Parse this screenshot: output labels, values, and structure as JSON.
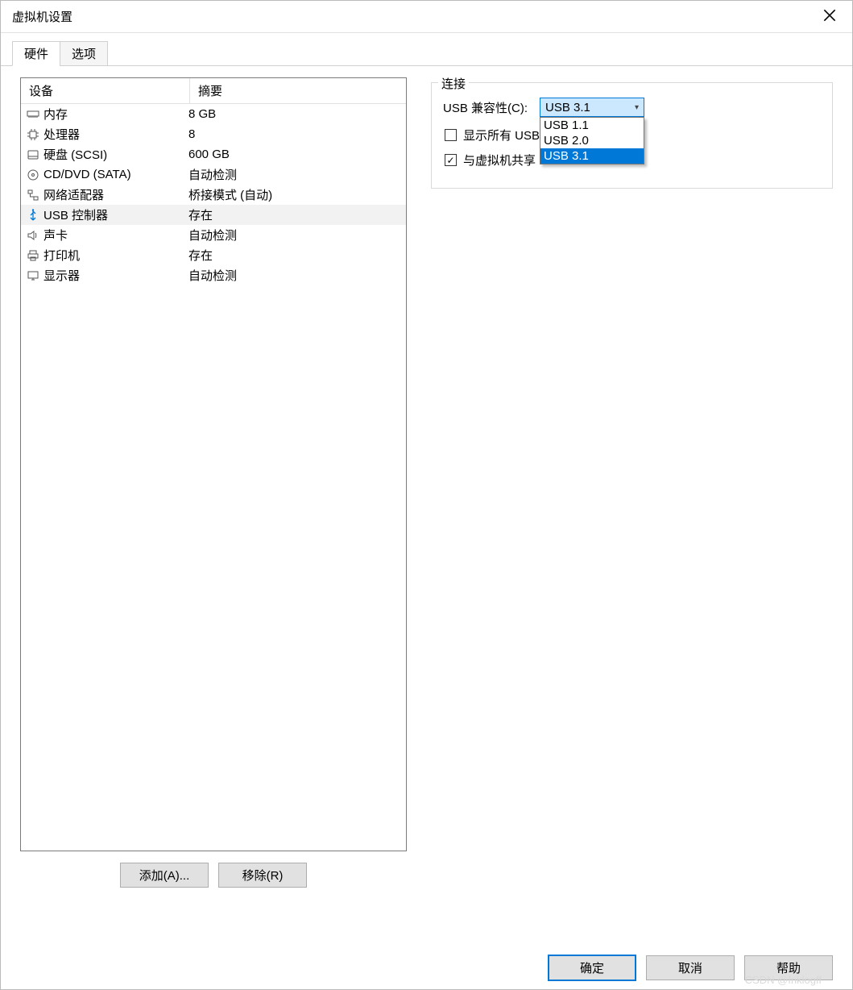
{
  "window": {
    "title": "虚拟机设置"
  },
  "tabs": {
    "hardware": "硬件",
    "options": "选项"
  },
  "list": {
    "header_device": "设备",
    "header_summary": "摘要",
    "items": [
      {
        "icon": "memory-icon",
        "label": "内存",
        "summary": "8 GB"
      },
      {
        "icon": "cpu-icon",
        "label": "处理器",
        "summary": "8"
      },
      {
        "icon": "disk-icon",
        "label": "硬盘 (SCSI)",
        "summary": "600 GB"
      },
      {
        "icon": "cd-icon",
        "label": "CD/DVD (SATA)",
        "summary": "自动检测"
      },
      {
        "icon": "network-icon",
        "label": "网络适配器",
        "summary": "桥接模式 (自动)"
      },
      {
        "icon": "usb-icon",
        "label": "USB 控制器",
        "summary": "存在"
      },
      {
        "icon": "sound-icon",
        "label": "声卡",
        "summary": "自动检测"
      },
      {
        "icon": "printer-icon",
        "label": "打印机",
        "summary": "存在"
      },
      {
        "icon": "display-icon",
        "label": "显示器",
        "summary": "自动检测"
      }
    ],
    "selected_index": 5,
    "add_button": "添加(A)...",
    "remove_button": "移除(R)"
  },
  "right": {
    "group_title": "连接",
    "compat_label": "USB 兼容性(C):",
    "compat_selected": "USB 3.1",
    "compat_options": [
      "USB 1.1",
      "USB 2.0",
      "USB 3.1"
    ],
    "compat_highlight_index": 2,
    "show_all_label": "显示所有 USB",
    "show_all_checked": false,
    "share_label": "与虚拟机共享",
    "share_checked": true
  },
  "footer": {
    "ok": "确定",
    "cancel": "取消",
    "help": "帮助"
  },
  "watermark": "CSDN @friklogff"
}
